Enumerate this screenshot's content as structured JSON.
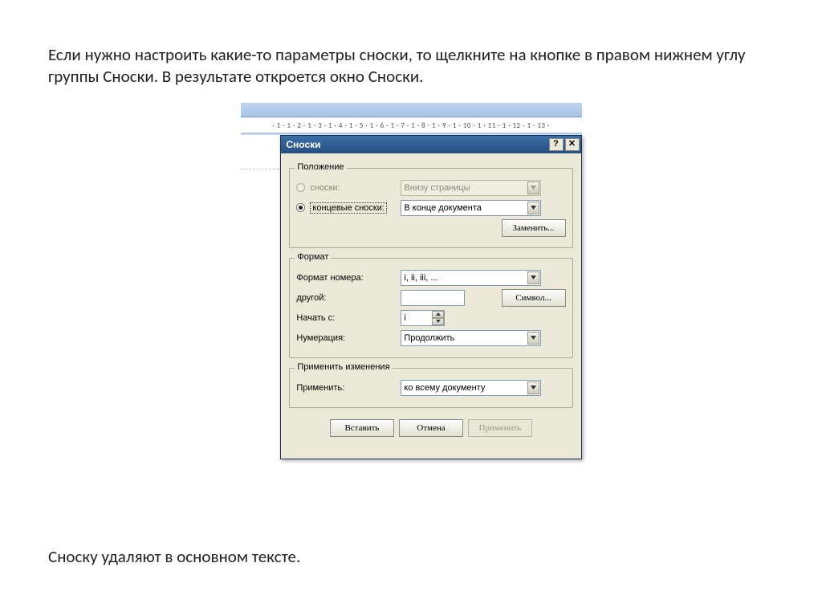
{
  "page": {
    "intro": "Если нужно настроить какие-то параметры сноски, то щелкните на кнопке в правом нижнем углу группы Сноски. В результате откроется окно Сноски.",
    "outro": "Сноску удаляют в основном тексте."
  },
  "ruler": "· 1 · 1 · 2 · 1 · 3 · 1 · 4 · 1 · 5 · 1 · 6 · 1 · 7 · 1 · 8 · 1 · 9 · 1 · 10 · 1 · 11 · 1 · 12 · 1 · 13 ·",
  "dialog": {
    "title": "Сноски",
    "help_btn": "?",
    "close_btn": "✕",
    "groups": {
      "position": {
        "label": "Положение",
        "opt_footnotes": "сноски:",
        "opt_footnotes_val": "Внизу страницы",
        "opt_endnotes": "концевые сноски:",
        "opt_endnotes_val": "В конце документа",
        "replace_btn": "Заменить..."
      },
      "format": {
        "label": "Формат",
        "number_format_lbl": "Формат номера:",
        "number_format_val": "i, ii, iii, ...",
        "custom_lbl": "другой:",
        "custom_val": "",
        "symbol_btn": "Символ...",
        "start_at_lbl": "Начать с:",
        "start_at_val": "i",
        "numbering_lbl": "Нумерация:",
        "numbering_val": "Продолжить"
      },
      "apply_changes": {
        "label": "Применить изменения",
        "apply_to_lbl": "Применить:",
        "apply_to_val": "ко всему документу"
      }
    },
    "buttons": {
      "insert": "Вставить",
      "cancel": "Отмена",
      "apply": "Применить"
    }
  }
}
